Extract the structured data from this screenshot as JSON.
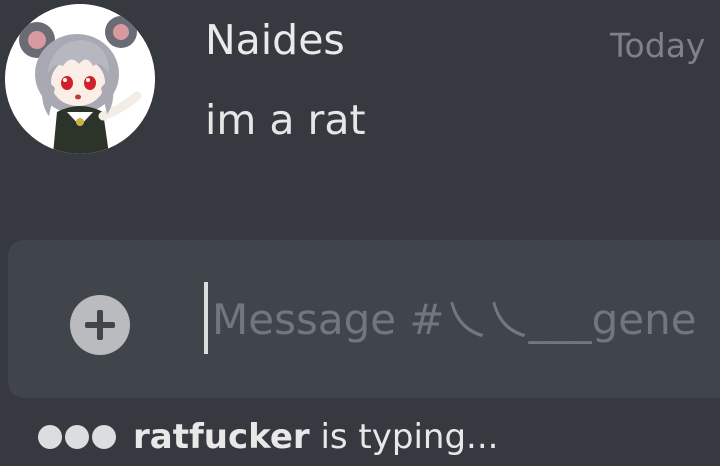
{
  "message": {
    "author": "Naides",
    "timestamp": "Today",
    "content": "im a rat"
  },
  "composer": {
    "placeholder": "Message #乀乀___gene"
  },
  "typing_indicator": {
    "user": "ratfucker",
    "text": " is typing..."
  },
  "icons": {
    "attach": "plus-circle-icon",
    "typing": "typing-dots-icon",
    "avatar": "rat-girl-avatar"
  },
  "colors": {
    "background": "#36393f",
    "composer": "#40444b",
    "attach_button": "#b9bbbe",
    "timestamp": "#7e8187"
  }
}
